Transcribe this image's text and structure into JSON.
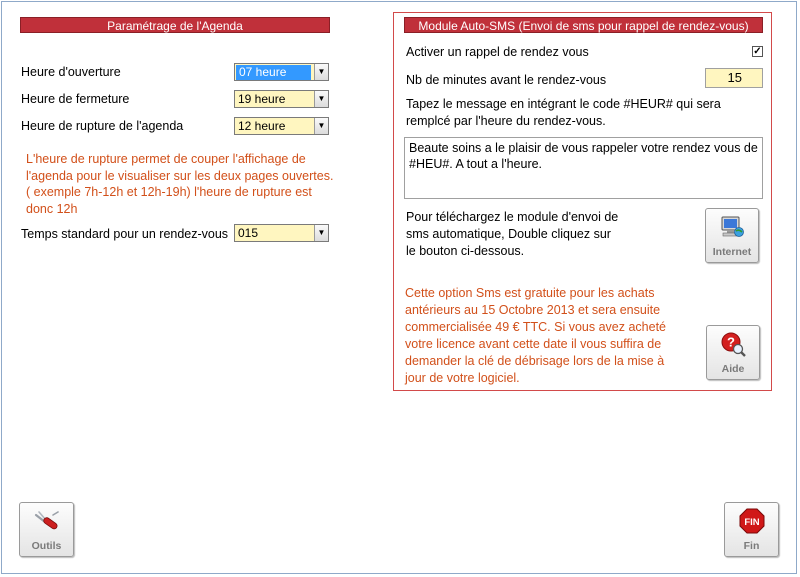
{
  "agenda": {
    "header": "Paramétrage de l'Agenda",
    "opening_label": "Heure d'ouverture",
    "opening_value": "07 heure",
    "closing_label": "Heure de fermeture",
    "closing_value": "19 heure",
    "break_label": "Heure de rupture de l'agenda",
    "break_value": "12 heure",
    "note_lines": [
      "L'heure de rupture permet de couper l'affichage de",
      "l'agenda pour le visualiser sur les deux pages ouvertes.",
      "( exemple 7h-12h  et 12h-19h) l'heure de rupture est",
      "donc 12h"
    ],
    "standard_time_label": "Temps standard pour un rendez-vous",
    "standard_time_value": "015"
  },
  "sms": {
    "header": "Module Auto-SMS (Envoi de sms pour rappel de rendez-vous)",
    "activate_label": "Activer un rappel de rendez vous",
    "activate_checked": true,
    "minutes_label": "Nb de minutes avant le rendez-vous",
    "minutes_value": "15",
    "instructions_lines": [
      "Tapez le message en intégrant le code #HEUR# qui sera",
      "remplcé par l'heure du rendez-vous."
    ],
    "message_lines": [
      "Beaute soins a le plaisir de vous rappeler votre rendez vous de",
      "#HEU#. A tout a l'heure."
    ],
    "download_lines": [
      "Pour téléchargez le module d'envoi de",
      "sms automatique, Double cliquez sur",
      "le bouton ci-dessous."
    ],
    "internet_button_label": "Internet",
    "offer_lines": [
      "Cette option Sms est gratuite pour les achats",
      "antérieurs au 15 Octobre 2013 et sera ensuite",
      "commercialisée 49 € TTC. Si vous avez acheté",
      "votre licence avant cette date il vous suffira de",
      "demander la clé de débrisage lors de la mise à",
      "jour de votre logiciel."
    ],
    "help_button_label": "Aide"
  },
  "footer": {
    "tools_button_label": "Outils",
    "end_button_label": "Fin",
    "end_icon_text": "FIN"
  },
  "colors": {
    "header_red": "#c0303a",
    "note_orange": "#d2501a",
    "field_yellow": "#fff6c0",
    "selection_blue": "#3399ff"
  }
}
